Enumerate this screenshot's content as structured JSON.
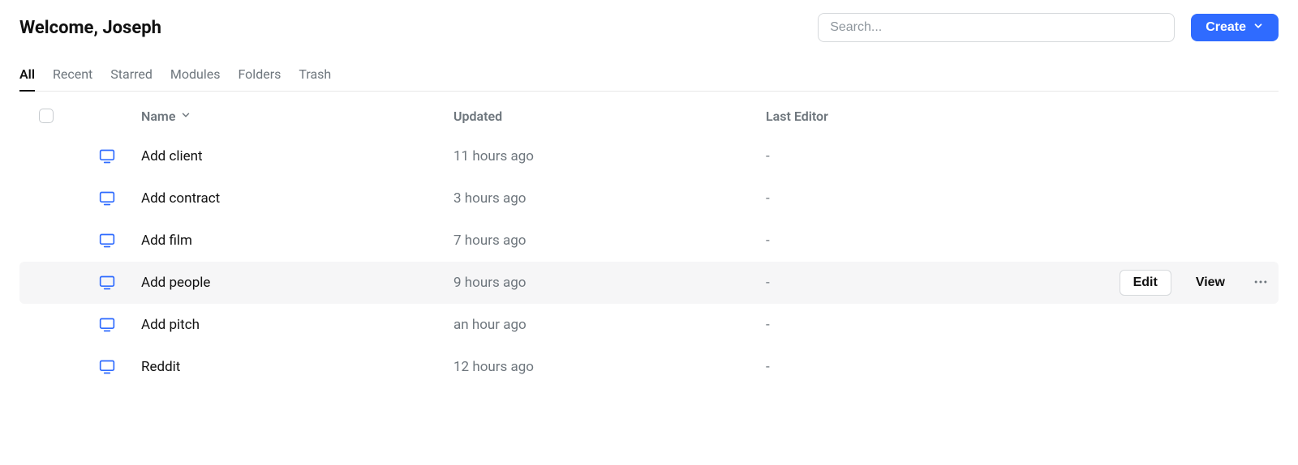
{
  "header": {
    "welcome": "Welcome, Joseph",
    "search_placeholder": "Search...",
    "create_label": "Create"
  },
  "tabs": [
    {
      "label": "All",
      "active": true
    },
    {
      "label": "Recent",
      "active": false
    },
    {
      "label": "Starred",
      "active": false
    },
    {
      "label": "Modules",
      "active": false
    },
    {
      "label": "Folders",
      "active": false
    },
    {
      "label": "Trash",
      "active": false
    }
  ],
  "columns": {
    "name": "Name",
    "updated": "Updated",
    "last_editor": "Last Editor"
  },
  "actions": {
    "edit": "Edit",
    "view": "View"
  },
  "rows": [
    {
      "name": "Add client",
      "updated": "11 hours ago",
      "editor": "-",
      "hovered": false
    },
    {
      "name": "Add contract",
      "updated": "3 hours ago",
      "editor": "-",
      "hovered": false
    },
    {
      "name": "Add film",
      "updated": "7 hours ago",
      "editor": "-",
      "hovered": false
    },
    {
      "name": "Add people",
      "updated": "9 hours ago",
      "editor": "-",
      "hovered": true
    },
    {
      "name": "Add pitch",
      "updated": "an hour ago",
      "editor": "-",
      "hovered": false
    },
    {
      "name": "Reddit",
      "updated": "12 hours ago",
      "editor": "-",
      "hovered": false
    }
  ]
}
